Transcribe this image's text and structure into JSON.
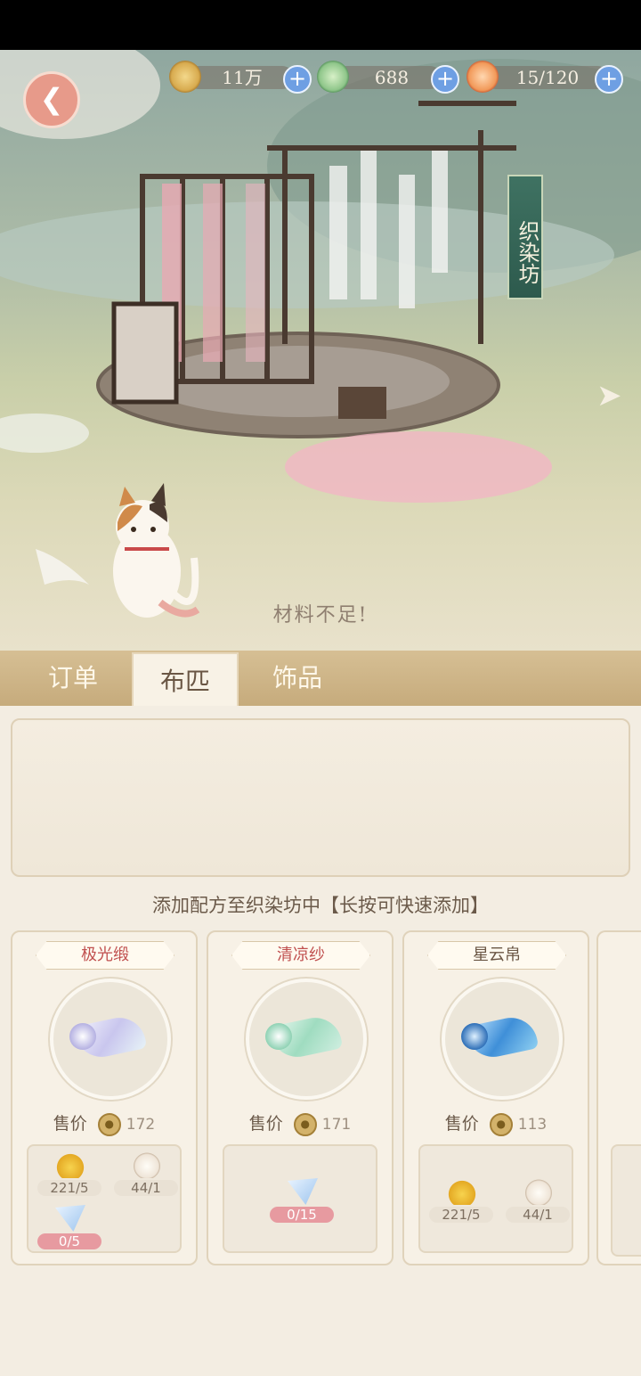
{
  "resources": [
    {
      "icon": "paw-coin-icon",
      "value": "11万"
    },
    {
      "icon": "jade-leaf-icon",
      "value": "688"
    },
    {
      "icon": "stamina-bun-icon",
      "value": "15/120"
    }
  ],
  "scene": {
    "shop_name": "织染坊",
    "message": "材料不足!"
  },
  "tabs": [
    {
      "label": "订单",
      "active": false
    },
    {
      "label": "布匹",
      "active": true
    },
    {
      "label": "饰品",
      "active": false
    }
  ],
  "hint": "添加配方至织染坊中【长按可快速添加】",
  "price_label": "售价",
  "recipes": [
    {
      "name": "极光缎",
      "name_color": "#c0504f",
      "price": "172",
      "cloth": "aurora",
      "materials": [
        {
          "icon": "lily-icon",
          "value": "221/5",
          "short": false
        },
        {
          "icon": "cotton-icon",
          "value": "44/1",
          "short": false
        },
        {
          "icon": "crystal-icon",
          "value": "0/5",
          "short": true
        }
      ]
    },
    {
      "name": "清凉纱",
      "name_color": "#c0504f",
      "price": "171",
      "cloth": "mint",
      "materials": [
        {
          "icon": "crystal-icon",
          "value": "0/15",
          "short": true
        }
      ]
    },
    {
      "name": "星云帛",
      "name_color": "#6a5644",
      "price": "113",
      "cloth": "nebula",
      "materials": [
        {
          "icon": "lily-icon",
          "value": "221/5",
          "short": false
        },
        {
          "icon": "cotton-icon",
          "value": "44/1",
          "short": false
        }
      ]
    }
  ]
}
